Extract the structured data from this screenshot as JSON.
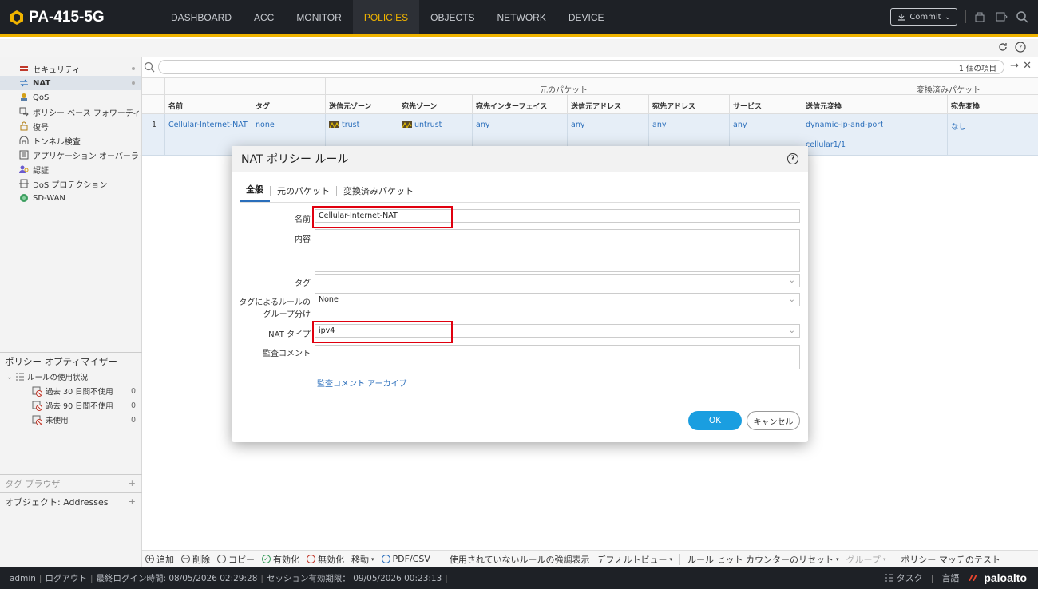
{
  "app": {
    "device_name": "PA-415-5G",
    "nav": [
      "DASHBOARD",
      "ACC",
      "MONITOR",
      "POLICIES",
      "OBJECTS",
      "NETWORK",
      "DEVICE"
    ],
    "active_nav": "POLICIES",
    "commit_label": "Commit",
    "accent_color": "#f0b400"
  },
  "sidebar": {
    "items": [
      {
        "label": "セキュリティ",
        "icon": "security-policy-icon"
      },
      {
        "label": "NAT",
        "icon": "nat-icon"
      },
      {
        "label": "QoS",
        "icon": "qos-icon"
      },
      {
        "label": "ポリシー ベース フォワーディング",
        "icon": "pbf-icon"
      },
      {
        "label": "復号",
        "icon": "decryption-icon"
      },
      {
        "label": "トンネル検査",
        "icon": "tunnel-inspection-icon"
      },
      {
        "label": "アプリケーション オーバーライド",
        "icon": "app-override-icon"
      },
      {
        "label": "認証",
        "icon": "authentication-icon"
      },
      {
        "label": "DoS プロテクション",
        "icon": "dos-protection-icon"
      },
      {
        "label": "SD-WAN",
        "icon": "sdwan-icon"
      }
    ],
    "optimizer": {
      "title": "ポリシー オプティマイザー",
      "section": "ルールの使用状況",
      "rows": [
        {
          "label": "過去 30 日間不使用",
          "count": "0"
        },
        {
          "label": "過去 90 日間不使用",
          "count": "0"
        },
        {
          "label": "未使用",
          "count": "0"
        }
      ]
    },
    "tag_browser": "タグ ブラウザ",
    "object_panel": "オブジェクト: Addresses"
  },
  "table": {
    "item_count": "1 個の項目",
    "group_source": "元のパケット",
    "group_translated": "変換済みパケット",
    "headers": {
      "name": "名前",
      "tag": "タグ",
      "src_zone": "送信元ゾーン",
      "dst_zone": "宛先ゾーン",
      "dst_interface": "宛先インターフェイス",
      "src_addr": "送信元アドレス",
      "dst_addr": "宛先アドレス",
      "service": "サービス",
      "src_trans": "送信元変換",
      "dst_trans": "宛先変換"
    },
    "row": {
      "num": "1",
      "name": "Cellular-Internet-NAT",
      "tag": "none",
      "src_zone": "trust",
      "dst_zone": "untrust",
      "dst_interface": "any",
      "src_addr": "any",
      "dst_addr": "any",
      "service": "any",
      "src_trans": "dynamic-ip-and-port",
      "src_trans_iface": "cellular1/1",
      "dst_trans": "なし"
    }
  },
  "actions": {
    "add": "追加",
    "delete": "削除",
    "copy": "コピー",
    "enable": "有効化",
    "disable": "無効化",
    "move": "移動",
    "pdf_csv": "PDF/CSV",
    "highlight_unused": "使用されていないルールの強調表示",
    "default_view": "デフォルトビュー",
    "reset_hit": "ルール ヒット カウンターのリセット",
    "group": "グループ",
    "test_match": "ポリシー マッチのテスト"
  },
  "status": {
    "user": "admin",
    "logout": "ログアウト",
    "last_login": "最終ログイン時間: 08/05/2026 02:29:28",
    "session_expiry": "セッション有効期限： 09/05/2026 00:23:13",
    "tasks": "タスク",
    "language": "言語",
    "logo": "paloalto"
  },
  "modal": {
    "title": "NAT ポリシー ルール",
    "tabs": [
      "全般",
      "元のパケット",
      "変換済みパケット"
    ],
    "active_tab": "全般",
    "fields": {
      "name_label": "名前",
      "name_value": "Cellular-Internet-NAT",
      "description_label": "内容",
      "tag_label": "タグ",
      "group_by_tag_label_1": "タグによるルールの",
      "group_by_tag_label_2": "グループ分け",
      "group_by_tag_value": "None",
      "nat_type_label": "NAT タイプ",
      "nat_type_value": "ipv4",
      "audit_comment_label": "監査コメント"
    },
    "audit_archive_link": "監査コメント アーカイブ",
    "ok": "OK",
    "cancel": "キャンセル"
  }
}
